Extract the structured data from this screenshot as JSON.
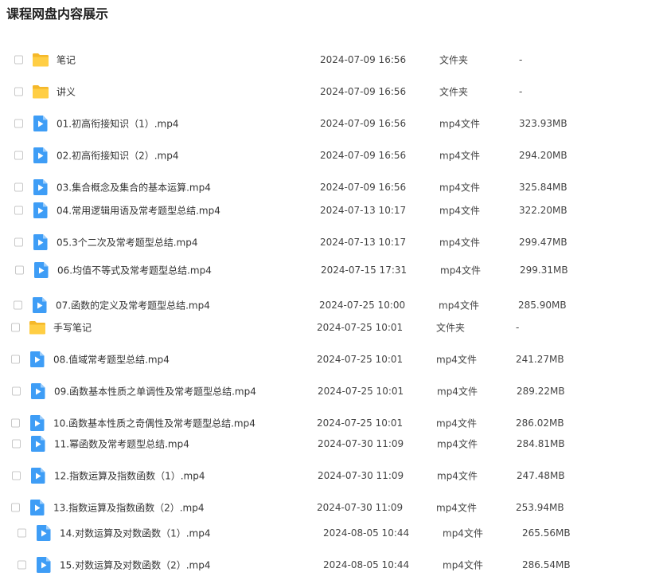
{
  "title": "课程网盘内容展示",
  "files": [
    {
      "name": "笔记",
      "date": "2024-07-09 16:56",
      "type": "文件夹",
      "size": "-",
      "kind": "folder"
    },
    {
      "name": "讲义",
      "date": "2024-07-09 16:56",
      "type": "文件夹",
      "size": "-",
      "kind": "folder"
    },
    {
      "name": "01.初高衔接知识（1）.mp4",
      "date": "2024-07-09 16:56",
      "type": "mp4文件",
      "size": "323.93MB",
      "kind": "video"
    },
    {
      "name": "02.初高衔接知识（2）.mp4",
      "date": "2024-07-09 16:56",
      "type": "mp4文件",
      "size": "294.20MB",
      "kind": "video"
    },
    {
      "name": "03.集合概念及集合的基本运算.mp4",
      "date": "2024-07-09 16:56",
      "type": "mp4文件",
      "size": "325.84MB",
      "kind": "video"
    },
    {
      "name": "04.常用逻辑用语及常考题型总结.mp4",
      "date": "2024-07-13 10:17",
      "type": "mp4文件",
      "size": "322.20MB",
      "kind": "video"
    },
    {
      "name": "05.3个二次及常考题型总结.mp4",
      "date": "2024-07-13 10:17",
      "type": "mp4文件",
      "size": "299.47MB",
      "kind": "video"
    },
    {
      "name": "06.均值不等式及常考题型总结.mp4",
      "date": "2024-07-15 17:31",
      "type": "mp4文件",
      "size": "299.31MB",
      "kind": "video"
    },
    {
      "name": "07.函数的定义及常考题型总结.mp4",
      "date": "2024-07-25 10:00",
      "type": "mp4文件",
      "size": "285.90MB",
      "kind": "video"
    },
    {
      "name": "手写笔记",
      "date": "2024-07-25 10:01",
      "type": "文件夹",
      "size": "-",
      "kind": "folder"
    },
    {
      "name": "08.值域常考题型总结.mp4",
      "date": "2024-07-25 10:01",
      "type": "mp4文件",
      "size": "241.27MB",
      "kind": "video"
    },
    {
      "name": "09.函数基本性质之单调性及常考题型总结.mp4",
      "date": "2024-07-25 10:01",
      "type": "mp4文件",
      "size": "289.22MB",
      "kind": "video"
    },
    {
      "name": "10.函数基本性质之奇偶性及常考题型总结.mp4",
      "date": "2024-07-25 10:01",
      "type": "mp4文件",
      "size": "286.02MB",
      "kind": "video"
    },
    {
      "name": "11.幂函数及常考题型总结.mp4",
      "date": "2024-07-30 11:09",
      "type": "mp4文件",
      "size": "284.81MB",
      "kind": "video"
    },
    {
      "name": "12.指数运算及指数函数（1）.mp4",
      "date": "2024-07-30 11:09",
      "type": "mp4文件",
      "size": "247.48MB",
      "kind": "video"
    },
    {
      "name": "13.指数运算及指数函数（2）.mp4",
      "date": "2024-07-30 11:09",
      "type": "mp4文件",
      "size": "253.94MB",
      "kind": "video"
    },
    {
      "name": "14.对数运算及对数函数（1）.mp4",
      "date": "2024-08-05 10:44",
      "type": "mp4文件",
      "size": "265.56MB",
      "kind": "video"
    },
    {
      "name": "15.对数运算及对数函数（2）.mp4",
      "date": "2024-08-05 10:44",
      "type": "mp4文件",
      "size": "286.54MB",
      "kind": "video"
    }
  ]
}
